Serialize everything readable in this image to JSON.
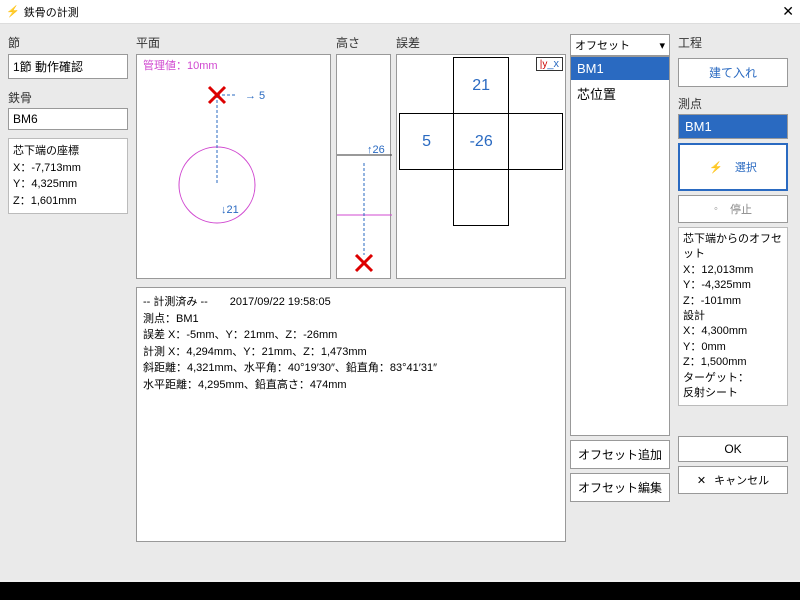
{
  "window": {
    "title": "鉄骨の計測"
  },
  "labels": {
    "section": "節",
    "plane": "平面",
    "height": "高さ",
    "error": "誤差",
    "steel": "鉄骨",
    "coord_header": "芯下端の座標",
    "process": "工程",
    "point": "測点",
    "offset_info_hdr": "芯下端からのオフセット"
  },
  "fields": {
    "section_value": "1節 動作確認",
    "steel_value": "BM6",
    "coord_x": "X：-7,713mm",
    "coord_y": "Y：4,325mm",
    "coord_z": "Z：1,601mm"
  },
  "plane": {
    "mgmt": "管理値：10mm",
    "dx": "→ 5",
    "dy": "↓21"
  },
  "heightbox": {
    "up": "↑26"
  },
  "err_grid": {
    "top": "21",
    "left": "5",
    "center": "-26"
  },
  "axis_label": "y x",
  "log": {
    "l1": "-- 計測済み --　　2017/09/22 19:58:05",
    "l2": "測点：BM1",
    "l3": "誤差 X：-5mm、Y：21mm、Z：-26mm",
    "l4": "計測 X：4,294mm、Y：21mm、Z：1,473mm",
    "l5": "斜距離：4,321mm、水平角：40°19′30″、鉛直角：83°41′31″",
    "l6": "水平距離：4,295mm、鉛直高さ：474mm"
  },
  "offset": {
    "combo": "オフセット",
    "items": [
      "BM1",
      "芯位置"
    ],
    "add": "オフセット追加",
    "edit": "オフセット編集"
  },
  "right": {
    "build": "建て入れ",
    "point_sel": "BM1",
    "select": "選択",
    "stop": "停止",
    "ok": "OK",
    "cancel": "キャンセル"
  },
  "offset_info": {
    "x": "X：12,013mm",
    "y": "Y：-4,325mm",
    "z": "Z：-101mm",
    "design": "設計",
    "dx": "X：4,300mm",
    "dy": "Y：0mm",
    "dz": "Z：1,500mm",
    "target_lbl": "ターゲット：",
    "target": "反射シート"
  }
}
